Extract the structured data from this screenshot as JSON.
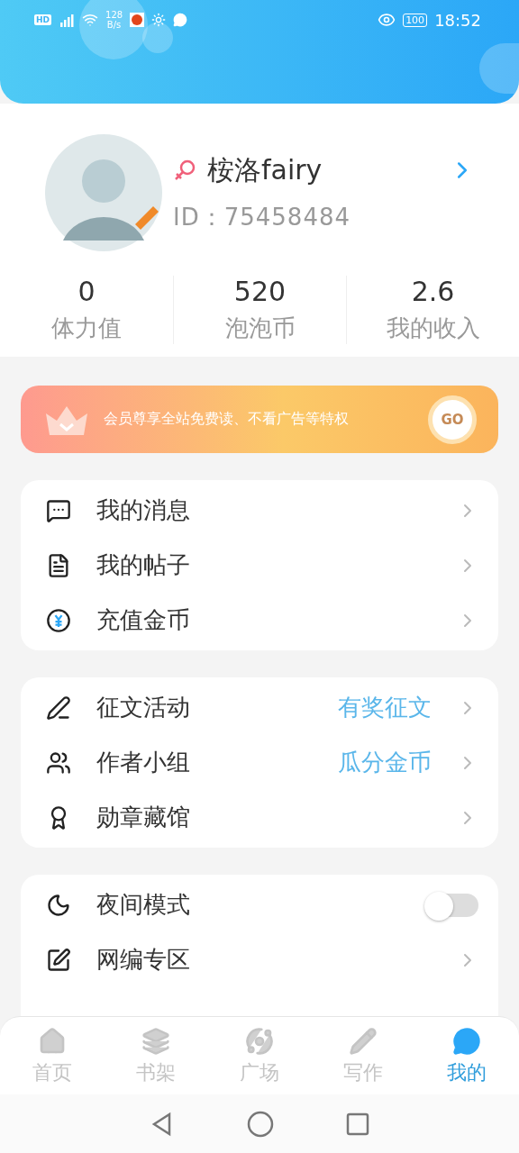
{
  "status_bar": {
    "hd": "HD",
    "network_speed": "128",
    "speed_unit": "B/s",
    "battery": "100",
    "time": "18:52"
  },
  "profile": {
    "name": "桉洛fairy",
    "id": "ID：75458484"
  },
  "stats": [
    {
      "value": "0",
      "label": "体力值"
    },
    {
      "value": "520",
      "label": "泡泡币"
    },
    {
      "value": "2.6",
      "label": "我的收入"
    }
  ],
  "vip_banner": {
    "text": "会员尊享全站免费读、不看广告等特权",
    "button": "GO"
  },
  "menu_groups": [
    {
      "items": [
        {
          "kind": "link",
          "label": "我的消息"
        },
        {
          "kind": "link",
          "label": "我的帖子"
        },
        {
          "kind": "link",
          "label": "充值金币"
        }
      ]
    },
    {
      "items": [
        {
          "kind": "link",
          "label": "征文活动",
          "tag": "有奖征文"
        },
        {
          "kind": "link",
          "label": "作者小组",
          "tag": "瓜分金币"
        },
        {
          "kind": "link",
          "label": "勋章藏馆"
        }
      ]
    },
    {
      "items": [
        {
          "kind": "toggle",
          "label": "夜间模式",
          "on": false
        },
        {
          "kind": "link",
          "label": "网编专区"
        }
      ]
    }
  ],
  "tabs": [
    {
      "label": "首页",
      "selected": false
    },
    {
      "label": "书架",
      "selected": false
    },
    {
      "label": "广场",
      "selected": false
    },
    {
      "label": "写作",
      "selected": false
    },
    {
      "label": "我的",
      "selected": true
    }
  ]
}
